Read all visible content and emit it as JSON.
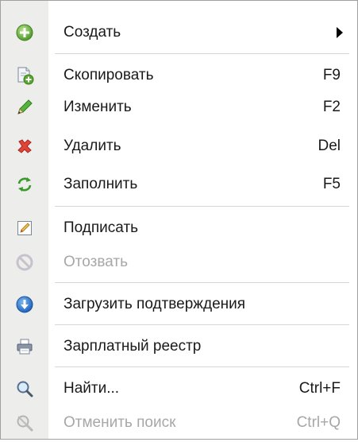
{
  "menu": {
    "items": [
      {
        "label": "Создать",
        "shortcut": "",
        "icon": "plus-circle-icon"
      },
      {
        "label": "Скопировать",
        "shortcut": "F9",
        "icon": "copy-icon"
      },
      {
        "label": "Изменить",
        "shortcut": "F2",
        "icon": "pencil-icon"
      },
      {
        "label": "Удалить",
        "shortcut": "Del",
        "icon": "delete-x-icon"
      },
      {
        "label": "Заполнить",
        "shortcut": "F5",
        "icon": "refresh-icon"
      },
      {
        "label": "Подписать",
        "shortcut": "",
        "icon": "sign-icon"
      },
      {
        "label": "Отозвать",
        "shortcut": "",
        "icon": "revoke-icon",
        "disabled": true
      },
      {
        "label": "Загрузить подтверждения",
        "shortcut": "",
        "icon": "download-icon"
      },
      {
        "label": "Зарплатный реестр",
        "shortcut": "",
        "icon": "printer-icon"
      },
      {
        "label": "Найти...",
        "shortcut": "Ctrl+F",
        "icon": "search-icon"
      },
      {
        "label": "Отменить поиск",
        "shortcut": "Ctrl+Q",
        "icon": "cancel-search-icon",
        "disabled": true
      }
    ]
  },
  "colors": {
    "gutter": "#ededeb",
    "text": "#1a1a1a",
    "disabled_text": "#a7a7a7",
    "separator": "#d7d7d7"
  }
}
